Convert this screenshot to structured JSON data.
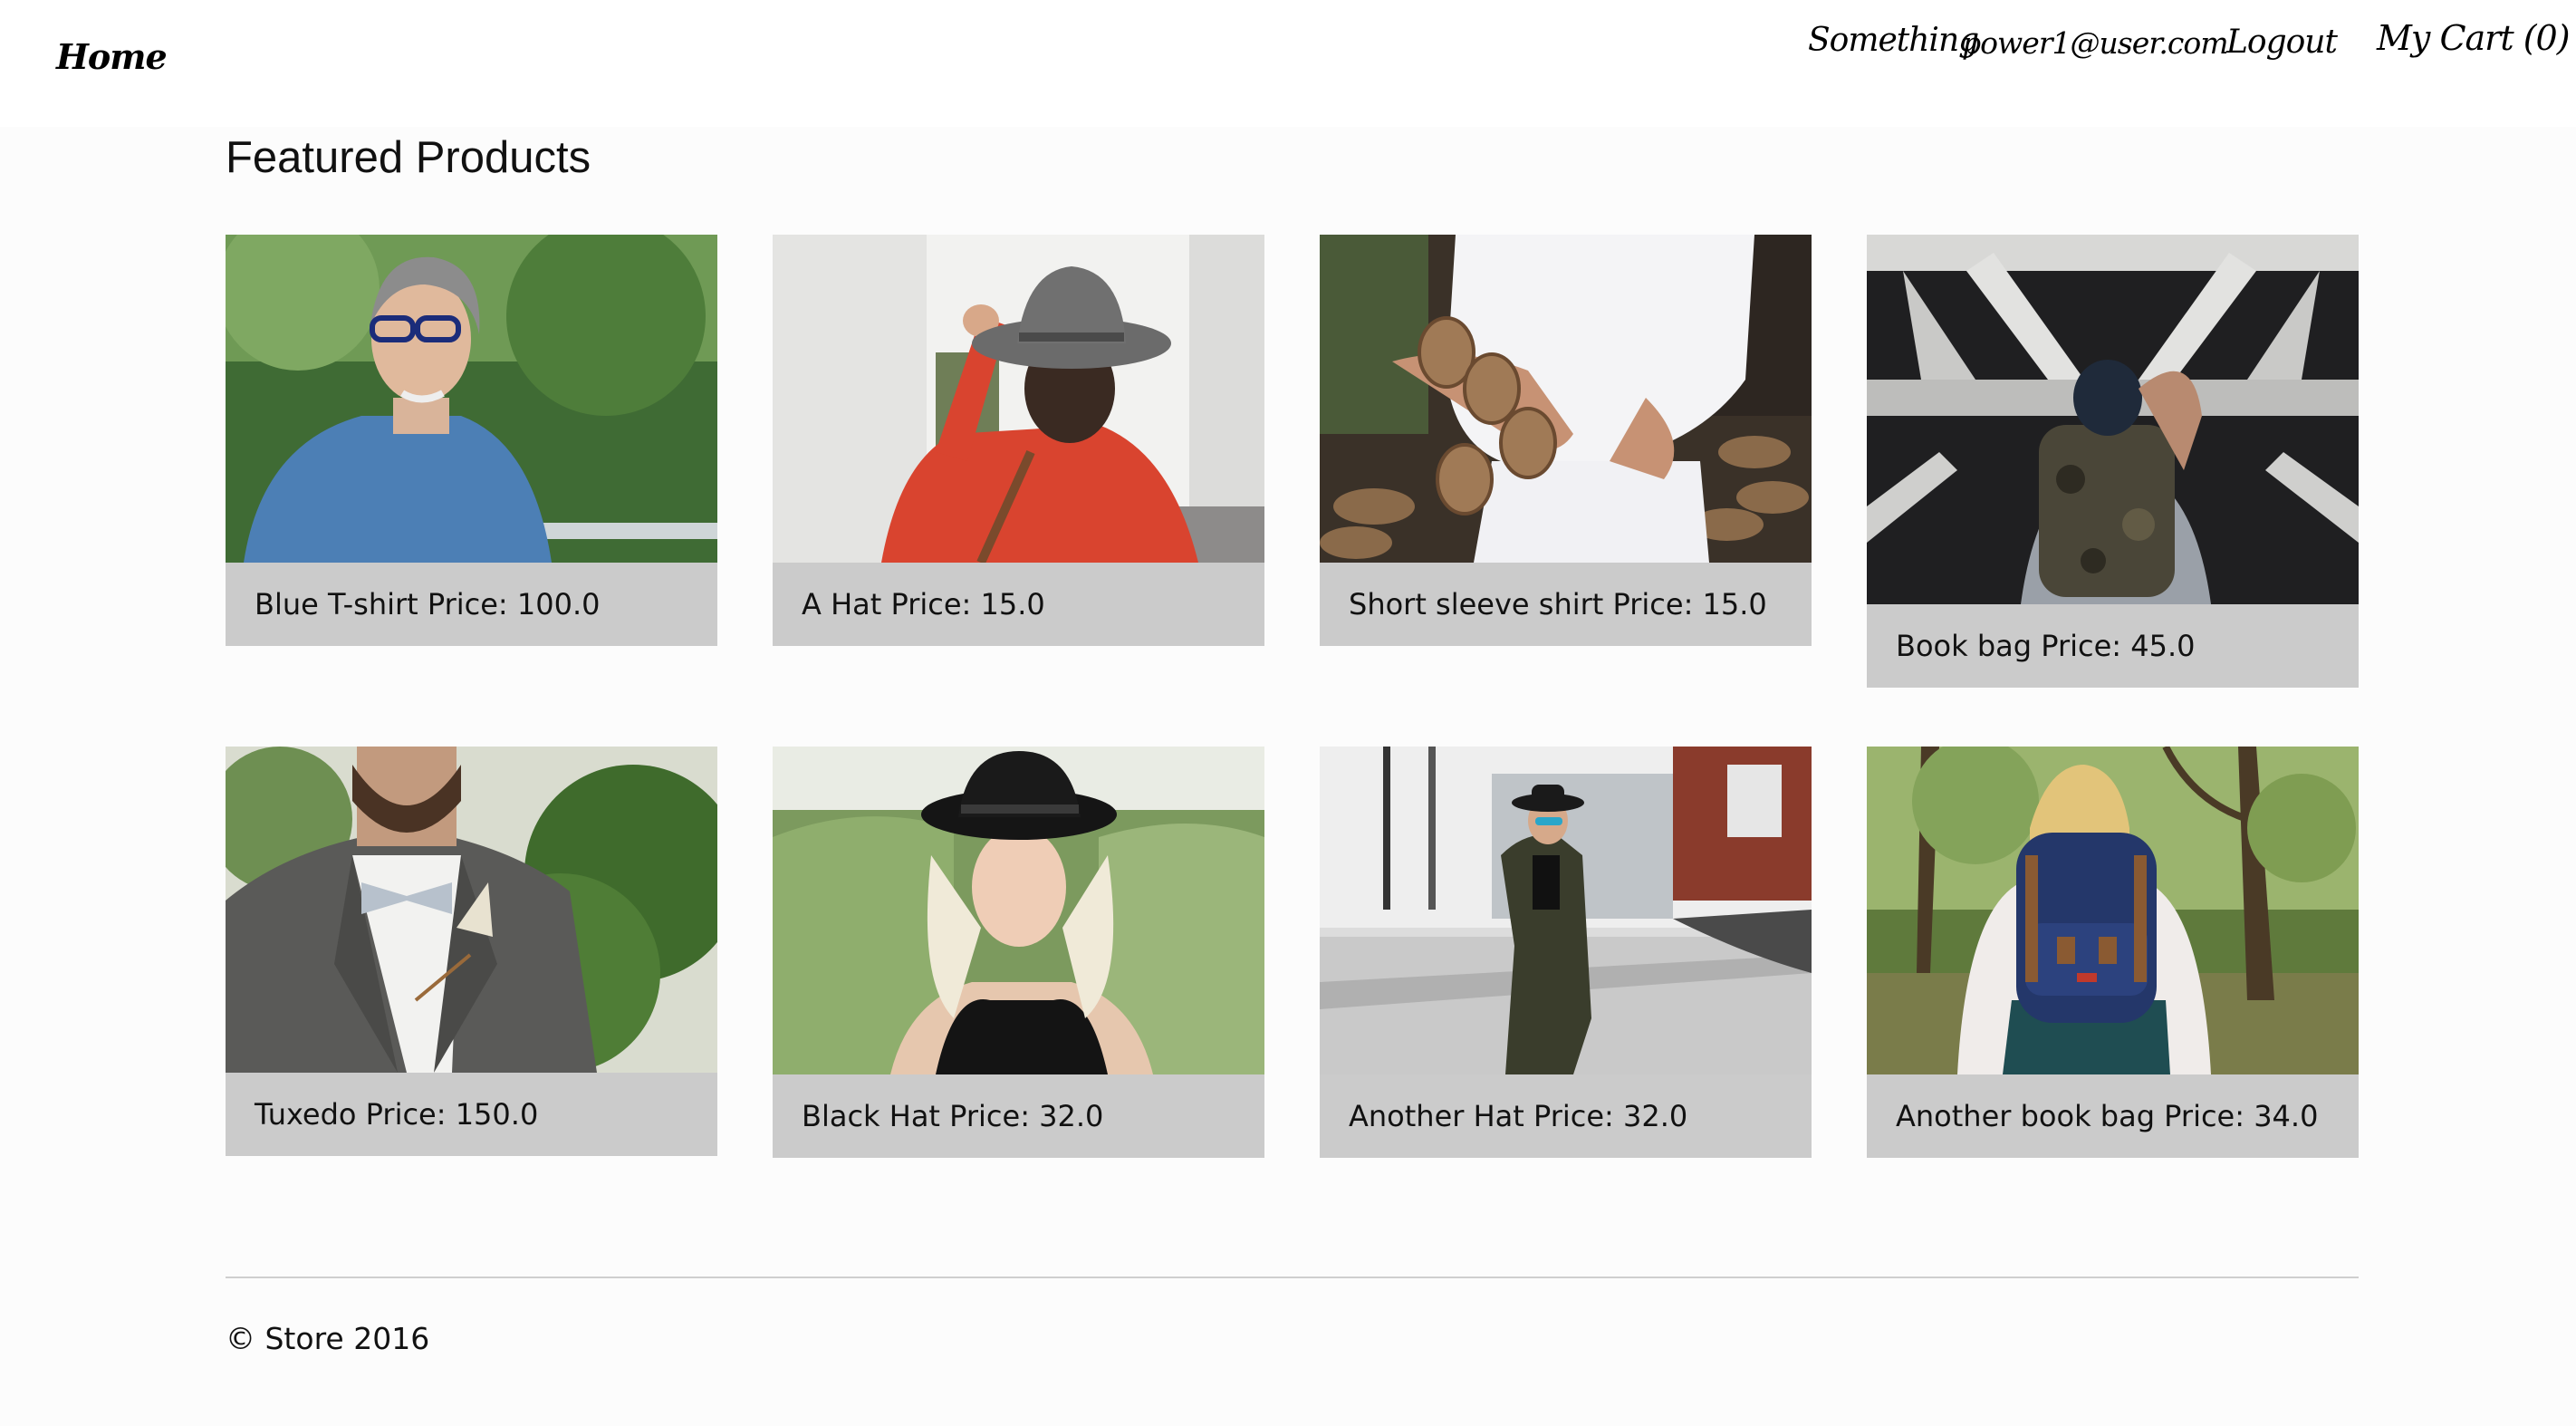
{
  "nav": {
    "home": "Home",
    "something": "Something",
    "email": "power1@user.com",
    "logout": "Logout",
    "cart": "My Cart (0)"
  },
  "main": {
    "title": "Featured Products"
  },
  "price_label": "Price:",
  "products": [
    {
      "name": "Blue T-shirt",
      "price": "100.0",
      "image": "man-blue-denim-shirt-glasses"
    },
    {
      "name": "A Hat",
      "price": "15.0",
      "image": "woman-red-blouse-grey-hat"
    },
    {
      "name": "Short sleeve shirt",
      "price": "15.0",
      "image": "man-carrying-firewood"
    },
    {
      "name": "Book bag",
      "price": "45.0",
      "image": "person-with-camo-backpack"
    },
    {
      "name": "Tuxedo",
      "price": "150.0",
      "image": "man-grey-suit-bowtie"
    },
    {
      "name": "Black Hat",
      "price": "32.0",
      "image": "blonde-woman-black-hat-field"
    },
    {
      "name": "Another Hat",
      "price": "32.0",
      "image": "woman-dark-coat-street"
    },
    {
      "name": "Another book bag",
      "price": "34.0",
      "image": "woman-navy-backpack-forest"
    }
  ],
  "footer": {
    "copyright": "© Store 2016"
  },
  "colors": {
    "caption_bg": "#cbcbcb",
    "page_bg": "#fcfcfc",
    "rule": "#cfcfcf"
  }
}
